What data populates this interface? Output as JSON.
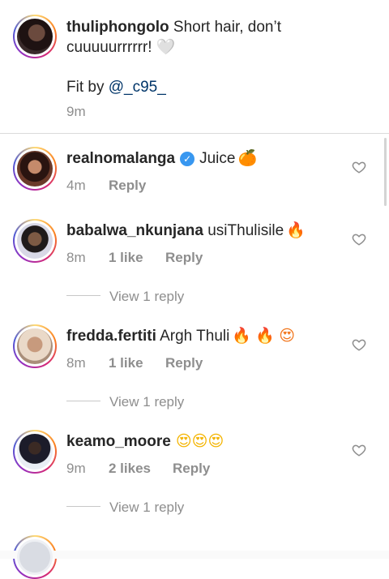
{
  "caption": {
    "username": "thuliphongolo",
    "text_line1": "Short hair, don’t",
    "text_line2": "cuuuuurrrrrr! 🤍",
    "fit_label": "Fit by",
    "mention": "@_c95_",
    "time": "9m"
  },
  "comments": [
    {
      "username": "realnomalanga",
      "verified": true,
      "text": "Juice",
      "emoji": "🍊",
      "time": "4m",
      "likes": "",
      "reply_label": "Reply"
    },
    {
      "username": "babalwa_nkunjana",
      "text": "usiThulisile",
      "emoji": "🔥",
      "time": "8m",
      "likes": "1 like",
      "reply_label": "Reply",
      "view_replies": "View 1 reply"
    },
    {
      "username": "fredda.fertiti",
      "text": "Argh Thuli",
      "emoji": "🔥 🔥 😍",
      "time": "8m",
      "likes": "1 like",
      "reply_label": "Reply",
      "view_replies": "View 1 reply"
    },
    {
      "username": "keamo_moore",
      "text": "",
      "emoji": "😍😍😍",
      "time": "9m",
      "likes": "2 likes",
      "reply_label": "Reply",
      "view_replies": "View 1 reply"
    }
  ],
  "icons": {
    "heart": "heart-outline-icon",
    "verified": "verified-badge-icon"
  },
  "colors": {
    "mention": "#003569",
    "meta": "#8e8e8e",
    "verified": "#3897f0"
  }
}
